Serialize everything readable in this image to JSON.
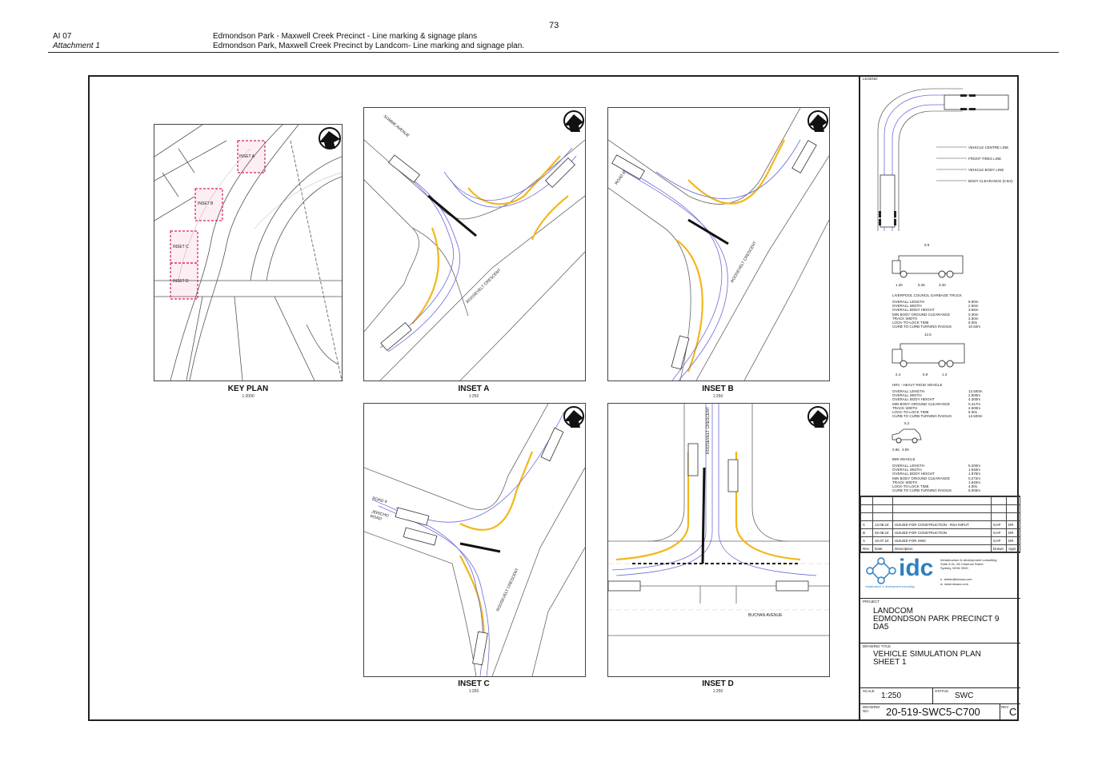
{
  "page_number": "73",
  "header": {
    "left1": "AI 07",
    "left2": "Attachment 1",
    "right1": "Edmondson Park - Maxwell Creek Precinct - Line marking & signage plans",
    "right2": "Edmondson Park, Maxwell Creek Precinct by Landcom- Line marking and signage plan."
  },
  "panels": {
    "key_plan": {
      "title": "KEY PLAN",
      "scale": "1:2000",
      "insets": [
        "INSET A",
        "INSET B",
        "INSET C",
        "INSET D"
      ]
    },
    "inset_a": {
      "title": "INSET A",
      "scale": "1:250",
      "street1": "SOMME AVENUE",
      "street2": "ROOSEVELT CRESCENT"
    },
    "inset_b": {
      "title": "INSET B",
      "scale": "1:250",
      "street1": "ROAD 8",
      "street2": "ROOSEVELT CRESCENT"
    },
    "inset_c": {
      "title": "INSET C",
      "scale": "1:250",
      "street1": "ROAD 8",
      "street2": "JERICHO ROAD",
      "street3": "ROOSEVELT CRESCENT"
    },
    "inset_d": {
      "title": "INSET D",
      "scale": "1:250",
      "street1": "ROOSEVELT CRESCENT",
      "street2": "BUCHAN AVENUE"
    }
  },
  "legend": {
    "title": "LEGEND",
    "items": [
      "VEHICLE CENTRE LINE",
      "FRONT TIRES LINE",
      "VEHICLE BODY LINE",
      "BODY CLEARANCE (0.5m)"
    ],
    "vehicles": [
      {
        "length_label": "9.9",
        "dims": [
          "1.25",
          "5.25",
          "3.40"
        ],
        "name": "LIVERPOOL COUNCIL GARBAGE TRUCK",
        "specs": [
          "OVERALL LENGTH",
          "OVERALL WIDTH",
          "OVERALL BODY HEIGHT",
          "MIN BODY GROUND CLEARANCE",
          "TRACK WIDTH",
          "LOCK-TO-LOCK TIME",
          "CURB TO CURB TURNING RADIUS"
        ],
        "values": [
          "9.90m",
          "2.50m",
          "3.55m",
          "0.30m",
          "2.50m",
          "6.00s",
          "10.50m"
        ]
      },
      {
        "length_label": "12.5",
        "dims": [
          "2.4",
          "5.9",
          "1.4"
        ],
        "name": "HRV - HEAVY RIGID VEHICLE",
        "specs": [
          "OVERALL LENGTH",
          "OVERALL WIDTH",
          "OVERALL BODY HEIGHT",
          "MIN BODY GROUND CLEARANCE",
          "TRACK WIDTH",
          "LOCK-TO-LOCK TIME",
          "CURB TO CURB TURNING RADIUS"
        ],
        "values": [
          "12.500m",
          "2.500m",
          "4.300m",
          "0.417m",
          "2.500m",
          "6.00s",
          "12.500m"
        ]
      },
      {
        "length_label": "5.2",
        "dims": [
          "0.95",
          "3.05"
        ],
        "name": "B99 VEHICLE",
        "specs": [
          "OVERALL LENGTH",
          "OVERALL WIDTH",
          "OVERALL BODY HEIGHT",
          "MIN BODY GROUND CLEARANCE",
          "TRACK WIDTH",
          "LOCK-TO-LOCK TIME",
          "CURB TO CURB TURNING RADIUS"
        ],
        "values": [
          "5.200m",
          "1.940m",
          "1.878m",
          "0.272m",
          "1.840m",
          "4.00s",
          "6.000m"
        ]
      }
    ]
  },
  "revisions": {
    "headers": [
      "Rev",
      "Date",
      "Description",
      "Drawn",
      "Appr"
    ],
    "rows": [
      [
        "C",
        "13.08.24",
        "ISSUED FOR CONSTRUCTION - RSA INPUT",
        "GAP",
        "DR"
      ],
      [
        "B",
        "02.08.24",
        "ISSUED FOR CONSTRUCTION",
        "GAP",
        "DR"
      ],
      [
        "A",
        "10.07.24",
        "ISSUED FOR SWC",
        "GAP",
        "DR"
      ]
    ]
  },
  "company": {
    "logo_text": "idc",
    "tagline": "infrastructure & development consulting",
    "address": [
      "Infrastructure & development consulting",
      "Suite 5.01, 56 Clarence Street",
      "Sydney, NSW 2000"
    ],
    "email": "admin@idcaus.com",
    "web": "www.idcaus.com"
  },
  "project": {
    "label": "PROJECT",
    "line1": "LANDCOM",
    "line2": "EDMONDSON PARK PRECINCT 9",
    "line3": "DA5"
  },
  "drawing_title": {
    "label": "DRAWING TITLE",
    "line1": "VEHICLE SIMULATION PLAN",
    "line2": "SHEET 1"
  },
  "scale": {
    "label": "SCALE",
    "value": "1:250"
  },
  "status": {
    "label": "STATUS",
    "value": "SWC"
  },
  "drawing_no": {
    "label1": "DRAWING",
    "label2": "NO.",
    "value": "20-519-SWC5-C700"
  },
  "rev": {
    "label": "REV",
    "value": "C"
  },
  "colors": {
    "yellow_line": "#f2b71a",
    "inset_box": "#d6245c",
    "path_blue": "#6b6bd6",
    "lines": "#555555"
  }
}
